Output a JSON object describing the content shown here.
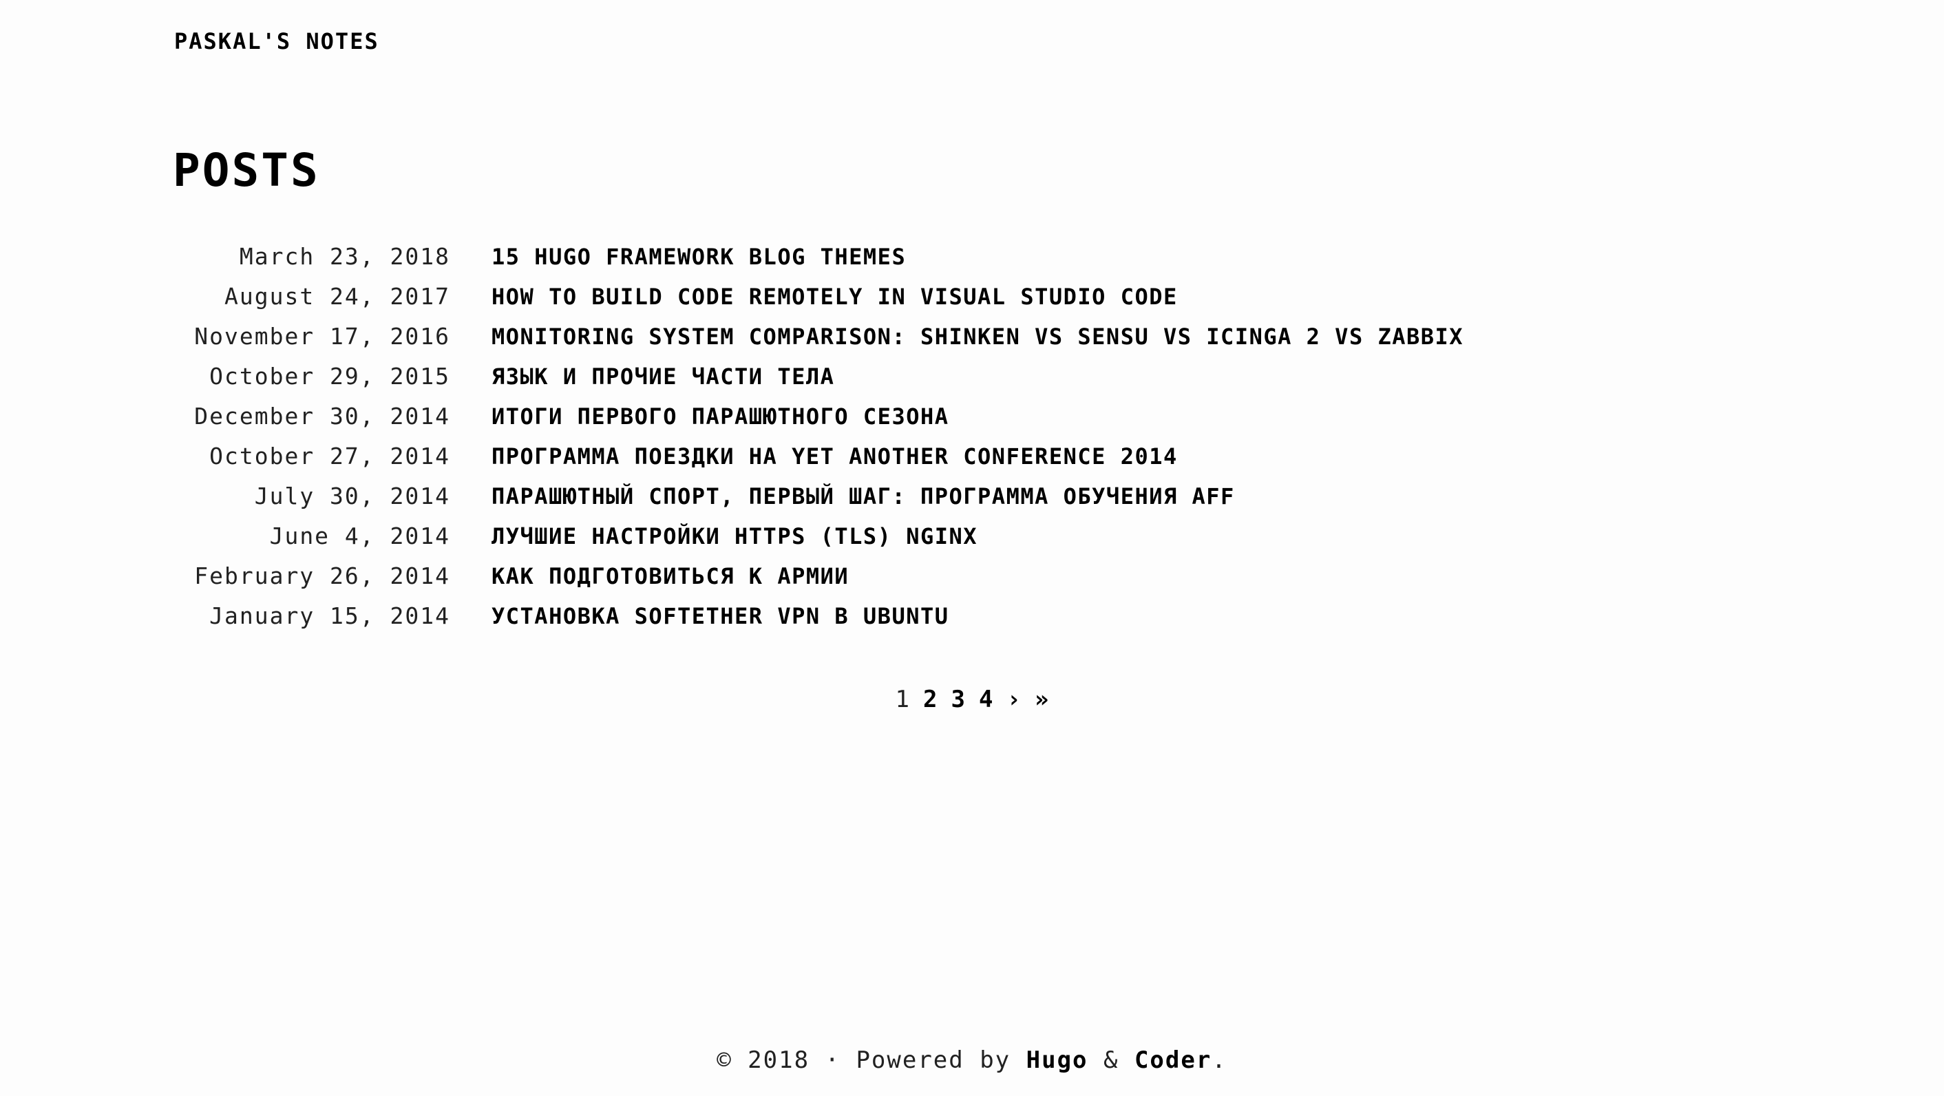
{
  "header": {
    "site_title": "PASKAL'S NOTES"
  },
  "main": {
    "title": "POSTS",
    "posts": [
      {
        "date": "March 23, 2018",
        "title": "15 HUGO FRAMEWORK BLOG THEMES"
      },
      {
        "date": "August 24, 2017",
        "title": "HOW TO BUILD CODE REMOTELY IN VISUAL STUDIO CODE"
      },
      {
        "date": "November 17, 2016",
        "title": "MONITORING SYSTEM COMPARISON: SHINKEN VS SENSU VS ICINGA 2 VS ZABBIX"
      },
      {
        "date": "October 29, 2015",
        "title": "ЯЗЫК И ПРОЧИЕ ЧАСТИ ТЕЛА"
      },
      {
        "date": "December 30, 2014",
        "title": "ИТОГИ ПЕРВОГО ПАРАШЮТНОГО СЕЗОНА"
      },
      {
        "date": "October 27, 2014",
        "title": "ПРОГРАММА ПОЕЗДКИ НА YET ANOTHER CONFERENCE 2014"
      },
      {
        "date": "July 30, 2014",
        "title": "ПАРАШЮТНЫЙ СПОРТ, ПЕРВЫЙ ШАГ: ПРОГРАММА ОБУЧЕНИЯ AFF"
      },
      {
        "date": "June 4, 2014",
        "title": "ЛУЧШИЕ НАСТРОЙКИ HTTPS (TLS) NGINX"
      },
      {
        "date": "February 26, 2014",
        "title": "КАК ПОДГОТОВИТЬСЯ К АРМИИ"
      },
      {
        "date": "January 15, 2014",
        "title": "УСТАНОВКА SOFTETHER VPN В UBUNTU"
      }
    ]
  },
  "pagination": {
    "current": "1",
    "pages": [
      "2",
      "3",
      "4"
    ],
    "next": "›",
    "last": "»"
  },
  "footer": {
    "copyright": "© 2018 · Powered by ",
    "hugo": "Hugo",
    "amp": " & ",
    "coder": "Coder",
    "period": "."
  }
}
